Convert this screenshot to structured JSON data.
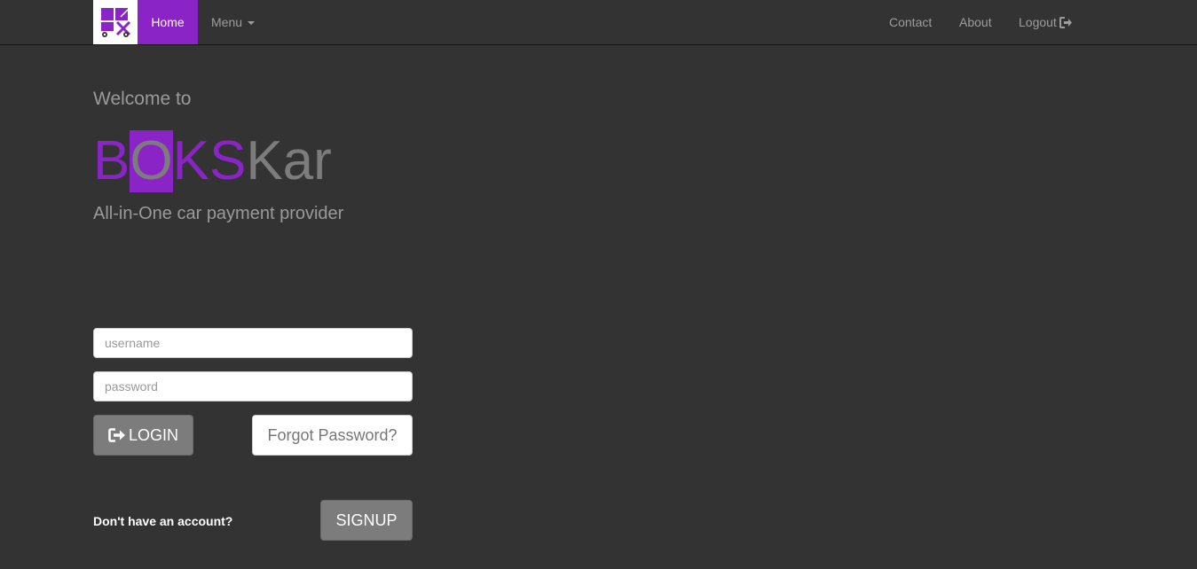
{
  "navbar": {
    "brand_icon": "boks-logo-icon",
    "home_label": "Home",
    "menu_label": "Menu",
    "contact_label": "Contact",
    "about_label": "About",
    "logout_label": "Logout",
    "logout_icon": "sign-out-icon"
  },
  "hero": {
    "welcome": "Welcome to",
    "logo": {
      "part1": "B",
      "part2": "O",
      "part3": "KS",
      "part4": "Kar"
    },
    "tagline": "All-in-One car payment provider"
  },
  "form": {
    "username_placeholder": "username",
    "password_placeholder": "password",
    "login_label": "LOGIN",
    "login_icon": "sign-in-icon",
    "forgot_label": "Forgot Password?",
    "no_account_text": "Don't have an account?",
    "signup_label": "SIGNUP"
  },
  "colors": {
    "accent": "#8a24c7",
    "background": "#333333",
    "muted_text": "#9a9a9a",
    "button_gray": "#7c7c7c"
  }
}
